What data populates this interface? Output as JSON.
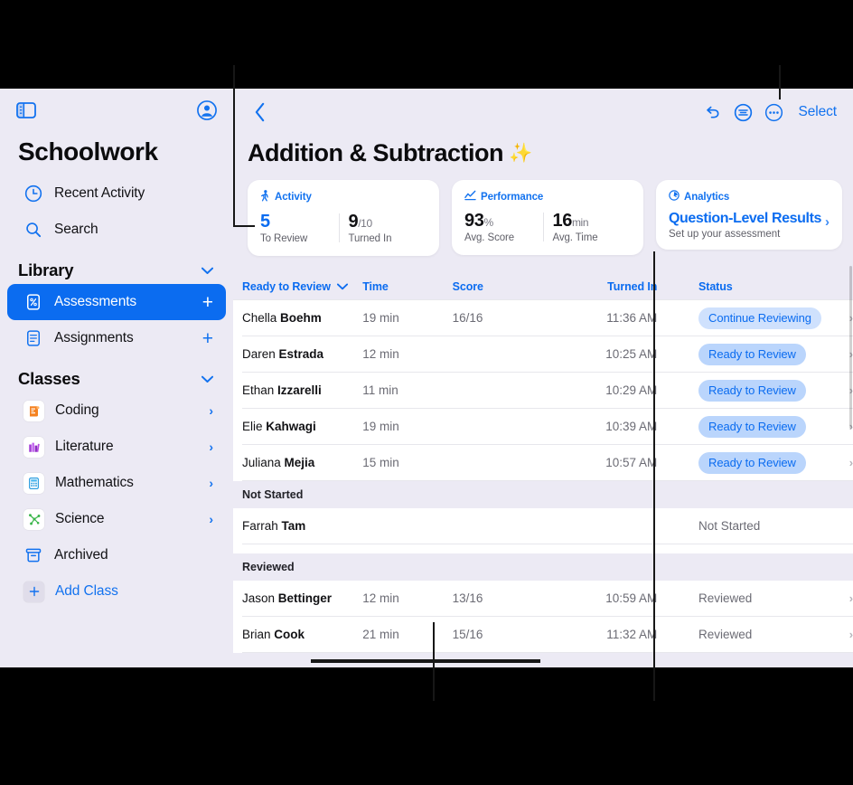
{
  "sidebar": {
    "top_icons": [
      {
        "name": "sidebar-toggle-icon",
        "label": "Sidebar"
      },
      {
        "name": "account-icon",
        "label": "Account"
      }
    ],
    "app_title": "Schoolwork",
    "quick_items": [
      {
        "label": "Recent Activity",
        "icon": "clock-icon"
      },
      {
        "label": "Search",
        "icon": "search-icon"
      }
    ],
    "library": {
      "header": "Library",
      "items": [
        {
          "label": "Assessments",
          "icon": "assessment-icon",
          "selected": true,
          "action": "+"
        },
        {
          "label": "Assignments",
          "icon": "assignment-icon",
          "selected": false,
          "action": "+"
        }
      ]
    },
    "classes": {
      "header": "Classes",
      "items": [
        {
          "label": "Coding",
          "icon": "coding-icon",
          "chevron": "›"
        },
        {
          "label": "Literature",
          "icon": "literature-icon",
          "chevron": "›"
        },
        {
          "label": "Mathematics",
          "icon": "mathematics-icon",
          "chevron": "›"
        },
        {
          "label": "Science",
          "icon": "science-icon",
          "chevron": "›"
        },
        {
          "label": "Archived",
          "icon": "archive-icon",
          "chevron": ""
        }
      ],
      "add_class": "Add Class"
    }
  },
  "detail": {
    "toolbar": {
      "back": "‹",
      "undo_label": "Undo",
      "annotate_label": "Markup",
      "more_label": "More",
      "select_label": "Select"
    },
    "title": "Addition & Subtraction",
    "title_emoji": "✨",
    "cards": [
      {
        "id": "activity",
        "header": "Activity",
        "icon": "activity-walk-icon",
        "stats": [
          {
            "value": "5",
            "unit": "",
            "caption": "To Review",
            "accent": true
          },
          {
            "value": "9",
            "unit": "/10",
            "caption": "Turned In",
            "accent": false
          }
        ]
      },
      {
        "id": "performance",
        "header": "Performance",
        "icon": "performance-chart-icon",
        "stats": [
          {
            "value": "93",
            "unit": "%",
            "caption": "Avg. Score",
            "accent": false
          },
          {
            "value": "16",
            "unit": "min",
            "caption": "Avg. Time",
            "accent": false
          }
        ]
      },
      {
        "id": "analytics",
        "header": "Analytics",
        "icon": "analytics-clock-icon",
        "link_title": "Question-Level Results",
        "subtitle": "Set up your assessment",
        "chevron": "›"
      }
    ],
    "table": {
      "columns": {
        "name": "Ready to Review",
        "name_sort_icon": "chevron-down-icon",
        "time": "Time",
        "score": "Score",
        "turned_in": "Turned In",
        "status": "Status"
      },
      "sections": [
        {
          "title": "",
          "rows": [
            {
              "first": "Chella ",
              "last": "Boehm",
              "time": "19 min",
              "score": "16/16",
              "turned_in": "11:36 AM",
              "status": "Continue Reviewing",
              "status_style": "pill-strong",
              "arrow": "›"
            },
            {
              "first": "Daren ",
              "last": "Estrada",
              "time": "12 min",
              "score": "",
              "turned_in": "10:25 AM",
              "status": "Ready to Review",
              "status_style": "pill",
              "arrow": "›"
            },
            {
              "first": "Ethan ",
              "last": "Izzarelli",
              "time": "11 min",
              "score": "",
              "turned_in": "10:29 AM",
              "status": "Ready to Review",
              "status_style": "pill",
              "arrow": "›"
            },
            {
              "first": "Elie ",
              "last": "Kahwagi",
              "time": "19 min",
              "score": "",
              "turned_in": "10:39 AM",
              "status": "Ready to Review",
              "status_style": "pill",
              "arrow": "›"
            },
            {
              "first": "Juliana ",
              "last": "Mejia",
              "time": "15 min",
              "score": "",
              "turned_in": "10:57 AM",
              "status": "Ready to Review",
              "status_style": "pill",
              "arrow": "›"
            }
          ]
        },
        {
          "title": "Not Started",
          "rows": [
            {
              "first": "Farrah ",
              "last": "Tam",
              "time": "",
              "score": "",
              "turned_in": "",
              "status": "Not Started",
              "status_style": "plain",
              "arrow": ""
            }
          ]
        },
        {
          "title": "Reviewed",
          "rows": [
            {
              "first": "Jason ",
              "last": "Bettinger",
              "time": "12 min",
              "score": "13/16",
              "turned_in": "10:59 AM",
              "status": "Reviewed",
              "status_style": "plain",
              "arrow": "›"
            },
            {
              "first": "Brian ",
              "last": "Cook",
              "time": "21 min",
              "score": "15/16",
              "turned_in": "11:32 AM",
              "status": "Reviewed",
              "status_style": "plain",
              "arrow": "›"
            }
          ]
        }
      ]
    }
  },
  "colors": {
    "accent_blue": "#0b6cf0",
    "link_blue": "#1272ef",
    "pill_bg": "#bad5fc",
    "sidebar_bg": "#eceaf4",
    "callout_line": "#171717"
  }
}
